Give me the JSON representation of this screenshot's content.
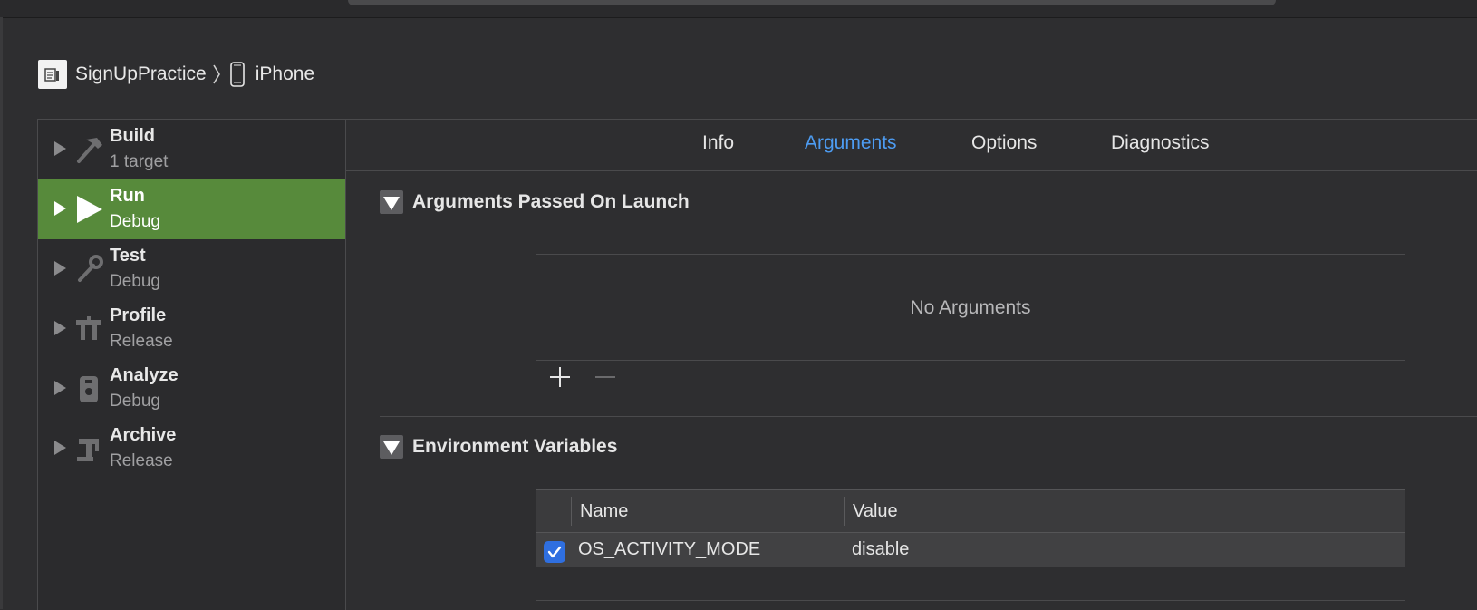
{
  "breadcrumb": {
    "project_name": "SignUpPractice",
    "device_name": "iPhone"
  },
  "sidebar": {
    "items": [
      {
        "title": "Build",
        "subtitle": "1 target",
        "icon": "hammer-icon",
        "selected": false
      },
      {
        "title": "Run",
        "subtitle": "Debug",
        "icon": "play-icon",
        "selected": true
      },
      {
        "title": "Test",
        "subtitle": "Debug",
        "icon": "wrench-icon",
        "selected": false
      },
      {
        "title": "Profile",
        "subtitle": "Release",
        "icon": "instruments-icon",
        "selected": false
      },
      {
        "title": "Analyze",
        "subtitle": "Debug",
        "icon": "analyze-icon",
        "selected": false
      },
      {
        "title": "Archive",
        "subtitle": "Release",
        "icon": "archive-icon",
        "selected": false
      }
    ],
    "selected_color": "#578a3b"
  },
  "tabs": [
    {
      "label": "Info",
      "active": false
    },
    {
      "label": "Arguments",
      "active": true
    },
    {
      "label": "Options",
      "active": false
    },
    {
      "label": "Diagnostics",
      "active": false
    }
  ],
  "accent_color": "#4d9cf2",
  "arguments_section": {
    "title": "Arguments Passed On Launch",
    "empty_text": "No Arguments",
    "add_label": "+",
    "remove_label": "−"
  },
  "env_section": {
    "title": "Environment Variables",
    "columns": {
      "name": "Name",
      "value": "Value"
    },
    "rows": [
      {
        "enabled": true,
        "name": "OS_ACTIVITY_MODE",
        "value": "disable"
      }
    ]
  }
}
